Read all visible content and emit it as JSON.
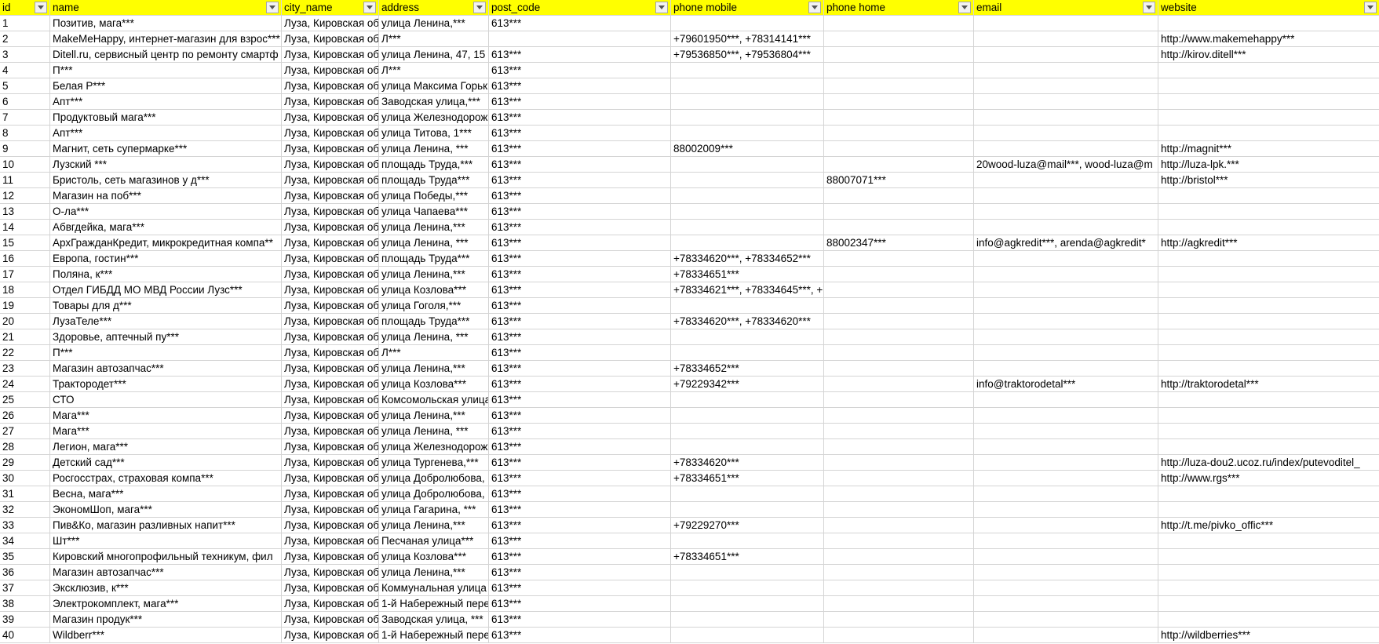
{
  "headers": [
    "id",
    "name",
    "city_name",
    "address",
    "post_code",
    "phone mobile",
    "phone home",
    "email",
    "website"
  ],
  "rows": [
    [
      "1",
      "Позитив, мага***",
      "Луза, Кировская об",
      "улица Ленина,***",
      "613***",
      "",
      "",
      "",
      ""
    ],
    [
      "2",
      "MakeMeHappy, интернет-магазин для взрос***",
      "Луза, Кировская об",
      "Л***",
      "",
      "+79601950***, +78314141***",
      "",
      "",
      "http://www.makemehappy***"
    ],
    [
      "3",
      "Ditell.ru, сервисный центр по ремонту смартф",
      "Луза, Кировская об",
      "улица Ленина, 47, 15 с",
      "613***",
      "+79536850***, +79536804***",
      "",
      "",
      "http://kirov.ditell***"
    ],
    [
      "4",
      "П***",
      "Луза, Кировская об",
      "Л***",
      "613***",
      "",
      "",
      "",
      ""
    ],
    [
      "5",
      "Белая Р***",
      "Луза, Кировская об",
      "улица Максима Горьк",
      "613***",
      "",
      "",
      "",
      ""
    ],
    [
      "6",
      "Апт***",
      "Луза, Кировская об",
      "Заводская улица,***",
      "613***",
      "",
      "",
      "",
      ""
    ],
    [
      "7",
      "Продуктовый мага***",
      "Луза, Кировская об",
      "улица Железнодорож",
      "613***",
      "",
      "",
      "",
      ""
    ],
    [
      "8",
      "Апт***",
      "Луза, Кировская об",
      "улица Титова, 1***",
      "613***",
      "",
      "",
      "",
      ""
    ],
    [
      "9",
      "Магнит, сеть супермарке***",
      "Луза, Кировская об",
      "улица Ленина, ***",
      "613***",
      "88002009***",
      "",
      "",
      "http://magnit***"
    ],
    [
      "10",
      "Лузский ***",
      "Луза, Кировская об",
      "площадь Труда,***",
      "613***",
      "",
      "",
      "20wood-luza@mail***, wood-luza@m",
      "http://luza-lpk.***"
    ],
    [
      "11",
      "Бристоль, сеть магазинов у д***",
      "Луза, Кировская об",
      "площадь Труда***",
      "613***",
      "",
      "88007071***",
      "",
      "http://bristol***"
    ],
    [
      "12",
      "Магазин на поб***",
      "Луза, Кировская об",
      "улица Победы,***",
      "613***",
      "",
      "",
      "",
      ""
    ],
    [
      "13",
      "О-ла***",
      "Луза, Кировская об",
      "улица Чапаева***",
      "613***",
      "",
      "",
      "",
      ""
    ],
    [
      "14",
      "Абвгдейка, мага***",
      "Луза, Кировская об",
      "улица Ленина,***",
      "613***",
      "",
      "",
      "",
      ""
    ],
    [
      "15",
      "АрхГражданКредит, микрокредитная компа**",
      "Луза, Кировская об",
      "улица Ленина, ***",
      "613***",
      "",
      "88002347***",
      "info@agkredit***, arenda@agkredit*",
      "http://agkredit***"
    ],
    [
      "16",
      "Европа, гостин***",
      "Луза, Кировская об",
      "площадь Труда***",
      "613***",
      "+78334620***, +78334652***",
      "",
      "",
      ""
    ],
    [
      "17",
      "Поляна, к***",
      "Луза, Кировская об",
      "улица Ленина,***",
      "613***",
      "+78334651***",
      "",
      "",
      ""
    ],
    [
      "18",
      "Отдел ГИБДД МО МВД России Лузс***",
      "Луза, Кировская об",
      "улица Козлова***",
      "613***",
      "+78334621***, +78334645***, +7",
      "",
      "",
      ""
    ],
    [
      "19",
      "Товары для д***",
      "Луза, Кировская об",
      "улица Гоголя,***",
      "613***",
      "",
      "",
      "",
      ""
    ],
    [
      "20",
      "ЛузаТеле***",
      "Луза, Кировская об",
      "площадь Труда***",
      "613***",
      "+78334620***, +78334620***",
      "",
      "",
      ""
    ],
    [
      "21",
      "Здоровье, аптечный пу***",
      "Луза, Кировская об",
      "улица Ленина, ***",
      "613***",
      "",
      "",
      "",
      ""
    ],
    [
      "22",
      "П***",
      "Луза, Кировская об",
      "Л***",
      "613***",
      "",
      "",
      "",
      ""
    ],
    [
      "23",
      "Магазин автозапчас***",
      "Луза, Кировская об",
      "улица Ленина,***",
      "613***",
      "+78334652***",
      "",
      "",
      ""
    ],
    [
      "24",
      "Трактородет***",
      "Луза, Кировская об",
      "улица Козлова***",
      "613***",
      "+79229342***",
      "",
      "info@traktorodetal***",
      "http://traktorodetal***"
    ],
    [
      "25",
      "СТО",
      "Луза, Кировская об",
      "Комсомольская улица",
      "613***",
      "",
      "",
      "",
      ""
    ],
    [
      "26",
      "Мага***",
      "Луза, Кировская об",
      "улица Ленина,***",
      "613***",
      "",
      "",
      "",
      ""
    ],
    [
      "27",
      "Мага***",
      "Луза, Кировская об",
      "улица Ленина, ***",
      "613***",
      "",
      "",
      "",
      ""
    ],
    [
      "28",
      "Легион, мага***",
      "Луза, Кировская об",
      "улица Железнодорож",
      "613***",
      "",
      "",
      "",
      ""
    ],
    [
      "29",
      "Детский сад***",
      "Луза, Кировская об",
      "улица Тургенева,***",
      "613***",
      "+78334620***",
      "",
      "",
      "http://luza-dou2.ucoz.ru/index/putevoditel_"
    ],
    [
      "30",
      "Росгосстрах, страховая компа***",
      "Луза, Кировская об",
      "улица Добролюбова,",
      "613***",
      "+78334651***",
      "",
      "",
      "http://www.rgs***"
    ],
    [
      "31",
      "Весна, мага***",
      "Луза, Кировская об",
      "улица Добролюбова,",
      "613***",
      "",
      "",
      "",
      ""
    ],
    [
      "32",
      "ЭкономШоп, мага***",
      "Луза, Кировская об",
      "улица Гагарина, ***",
      "613***",
      "",
      "",
      "",
      ""
    ],
    [
      "33",
      "Пив&Ко, магазин разливных напит***",
      "Луза, Кировская об",
      "улица Ленина,***",
      "613***",
      "+79229270***",
      "",
      "",
      "http://t.me/pivko_offic***"
    ],
    [
      "34",
      "Шт***",
      "Луза, Кировская об",
      "Песчаная улица***",
      "613***",
      "",
      "",
      "",
      ""
    ],
    [
      "35",
      "Кировский многопрофильный техникум, фил",
      "Луза, Кировская об",
      "улица Козлова***",
      "613***",
      "+78334651***",
      "",
      "",
      ""
    ],
    [
      "36",
      "Магазин автозапчас***",
      "Луза, Кировская об",
      "улица Ленина,***",
      "613***",
      "",
      "",
      "",
      ""
    ],
    [
      "37",
      "Эксклюзив, к***",
      "Луза, Кировская об",
      "Коммунальная улица",
      "613***",
      "",
      "",
      "",
      ""
    ],
    [
      "38",
      "Электрокомплект, мага***",
      "Луза, Кировская об",
      "1-й Набережный пере",
      "613***",
      "",
      "",
      "",
      ""
    ],
    [
      "39",
      "Магазин продук***",
      "Луза, Кировская об",
      "Заводская улица, ***",
      "613***",
      "",
      "",
      "",
      ""
    ],
    [
      "40",
      "Wildberr***",
      "Луза, Кировская об",
      "1-й Набережный пере",
      "613***",
      "",
      "",
      "",
      "http://wildberries***"
    ]
  ],
  "colors": {
    "header_bg": "#ffff00",
    "grid_line": "#d4d4d4",
    "text": "#000000"
  },
  "icons": {
    "filter": "filter-dropdown-arrow-icon"
  }
}
